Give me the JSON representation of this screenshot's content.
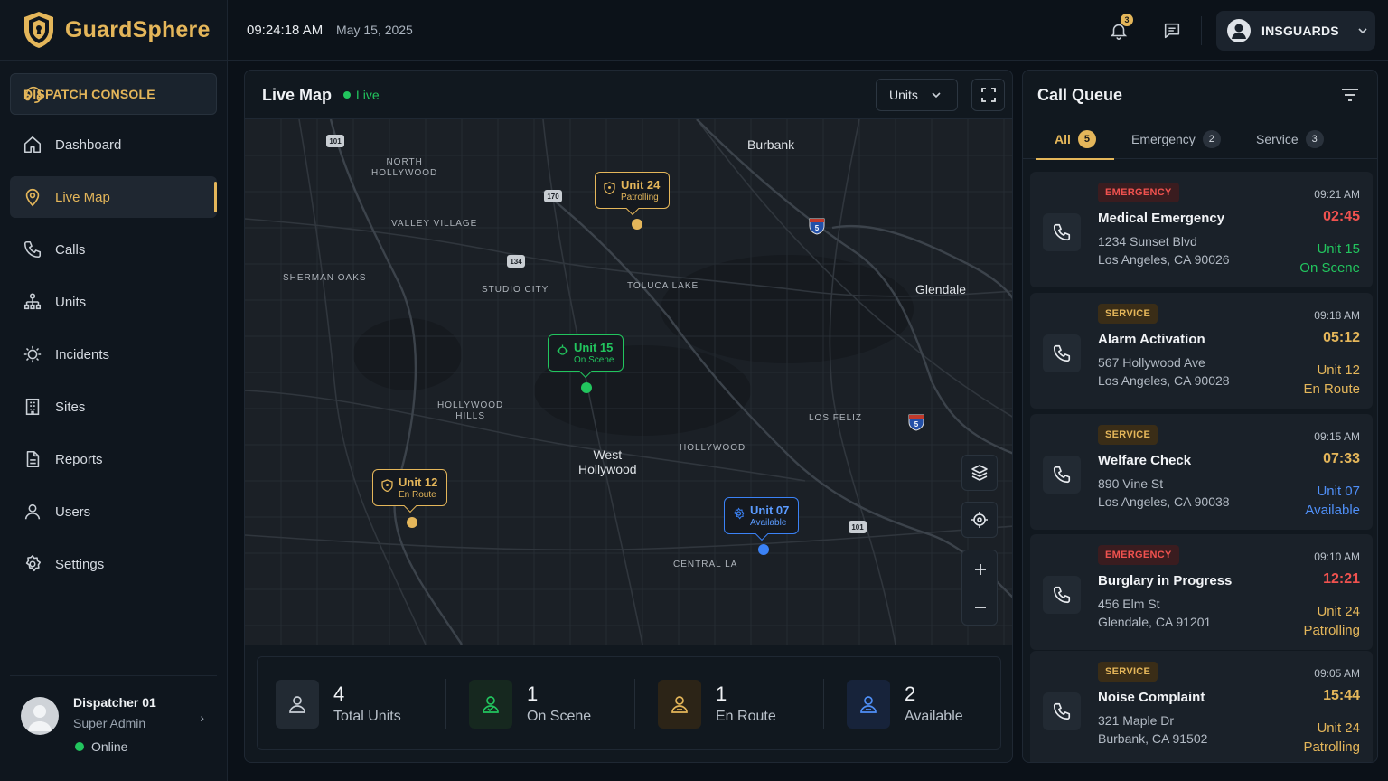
{
  "app": {
    "brand": "GuardSphere"
  },
  "colors": {
    "accent": "#e4b65a",
    "green": "#22c55e",
    "blue": "#3b82f6",
    "red": "#f0524f"
  },
  "sidebar": {
    "console_label": "DISPATCH CONSOLE",
    "items": [
      {
        "label": "Dashboard",
        "icon": "home-icon"
      },
      {
        "label": "Live Map",
        "icon": "map-pin-icon",
        "active": true
      },
      {
        "label": "Calls",
        "icon": "phone-icon"
      },
      {
        "label": "Units",
        "icon": "org-chart-icon"
      },
      {
        "label": "Incidents",
        "icon": "alert-siren-icon"
      },
      {
        "label": "Sites",
        "icon": "building-icon"
      },
      {
        "label": "Reports",
        "icon": "document-icon"
      },
      {
        "label": "Users",
        "icon": "user-icon"
      },
      {
        "label": "Settings",
        "icon": "gear-icon"
      }
    ],
    "user": {
      "name": "Dispatcher 01",
      "role": "Super Admin",
      "status": "Online"
    }
  },
  "topbar": {
    "time": "09:24:18 AM",
    "date": "May 15, 2025",
    "notifications": "3",
    "account": "INSGUARDS"
  },
  "map": {
    "title": "Live Map",
    "live_label": "Live",
    "filter": "Units",
    "labels": {
      "north_hollywood": "NORTH\nHOLLYWOOD",
      "valley_village": "VALLEY VILLAGE",
      "sherman_oaks": "SHERMAN OAKS",
      "studio_city": "STUDIO CITY",
      "toluca_lake": "TOLUCA LAKE",
      "hollywood_hills": "HOLLYWOOD\nHILLS",
      "hollywood": "HOLLYWOOD",
      "los_feliz": "LOS FELIZ",
      "central_la": "CENTRAL LA",
      "burbank": "Burbank",
      "glendale": "Glendale",
      "west_hollywood": "West\nHollywood"
    },
    "highways": [
      "101",
      "170",
      "134",
      "5",
      "101"
    ],
    "markers": [
      {
        "unit": "Unit 24",
        "status": "Patrolling",
        "color": "#e4b65a"
      },
      {
        "unit": "Unit 15",
        "status": "On Scene",
        "color": "#22c55e"
      },
      {
        "unit": "Unit 12",
        "status": "En Route",
        "color": "#e4b65a"
      },
      {
        "unit": "Unit 07",
        "status": "Available",
        "color": "#3b82f6"
      }
    ],
    "stats": [
      {
        "value": "4",
        "label": "Total Units"
      },
      {
        "value": "1",
        "label": "On Scene"
      },
      {
        "value": "1",
        "label": "En Route"
      },
      {
        "value": "2",
        "label": "Available"
      }
    ]
  },
  "queue": {
    "title": "Call Queue",
    "tabs": [
      {
        "label": "All",
        "count": "5"
      },
      {
        "label": "Emergency",
        "count": "2"
      },
      {
        "label": "Service",
        "count": "3"
      }
    ],
    "calls": [
      {
        "tag": "EMERGENCY",
        "title": "Medical Emergency",
        "addr1": "1234 Sunset Blvd",
        "addr2": "Los Angeles, CA 90026",
        "time": "09:21 AM",
        "timer": "02:45",
        "unit": "Unit 15",
        "status": "On Scene"
      },
      {
        "tag": "SERVICE",
        "title": "Alarm Activation",
        "addr1": "567 Hollywood Ave",
        "addr2": "Los Angeles, CA 90028",
        "time": "09:18 AM",
        "timer": "05:12",
        "unit": "Unit 12",
        "status": "En Route"
      },
      {
        "tag": "SERVICE",
        "title": "Welfare Check",
        "addr1": "890 Vine St",
        "addr2": "Los Angeles, CA 90038",
        "time": "09:15 AM",
        "timer": "07:33",
        "unit": "Unit 07",
        "status": "Available"
      },
      {
        "tag": "EMERGENCY",
        "title": "Burglary in Progress",
        "addr1": "456 Elm St",
        "addr2": "Glendale, CA 91201",
        "time": "09:10 AM",
        "timer": "12:21",
        "unit": "Unit 24",
        "status": "Patrolling"
      },
      {
        "tag": "SERVICE",
        "title": "Noise Complaint",
        "addr1": "321 Maple Dr",
        "addr2": "Burbank, CA 91502",
        "time": "09:05 AM",
        "timer": "15:44",
        "unit": "Unit 24",
        "status": "Patrolling"
      }
    ]
  }
}
